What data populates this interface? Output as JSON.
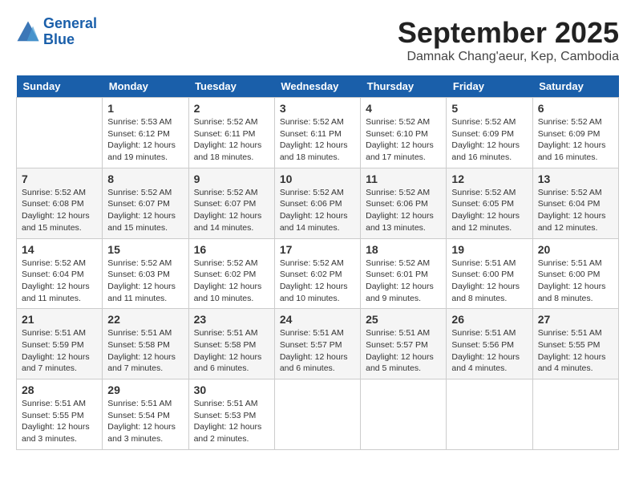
{
  "header": {
    "logo_line1": "General",
    "logo_line2": "Blue",
    "month_title": "September 2025",
    "subtitle": "Damnak Chang'aeur, Kep, Cambodia"
  },
  "weekdays": [
    "Sunday",
    "Monday",
    "Tuesday",
    "Wednesday",
    "Thursday",
    "Friday",
    "Saturday"
  ],
  "weeks": [
    [
      {
        "day": "",
        "info": ""
      },
      {
        "day": "1",
        "info": "Sunrise: 5:53 AM\nSunset: 6:12 PM\nDaylight: 12 hours\nand 19 minutes."
      },
      {
        "day": "2",
        "info": "Sunrise: 5:52 AM\nSunset: 6:11 PM\nDaylight: 12 hours\nand 18 minutes."
      },
      {
        "day": "3",
        "info": "Sunrise: 5:52 AM\nSunset: 6:11 PM\nDaylight: 12 hours\nand 18 minutes."
      },
      {
        "day": "4",
        "info": "Sunrise: 5:52 AM\nSunset: 6:10 PM\nDaylight: 12 hours\nand 17 minutes."
      },
      {
        "day": "5",
        "info": "Sunrise: 5:52 AM\nSunset: 6:09 PM\nDaylight: 12 hours\nand 16 minutes."
      },
      {
        "day": "6",
        "info": "Sunrise: 5:52 AM\nSunset: 6:09 PM\nDaylight: 12 hours\nand 16 minutes."
      }
    ],
    [
      {
        "day": "7",
        "info": "Sunrise: 5:52 AM\nSunset: 6:08 PM\nDaylight: 12 hours\nand 15 minutes."
      },
      {
        "day": "8",
        "info": "Sunrise: 5:52 AM\nSunset: 6:07 PM\nDaylight: 12 hours\nand 15 minutes."
      },
      {
        "day": "9",
        "info": "Sunrise: 5:52 AM\nSunset: 6:07 PM\nDaylight: 12 hours\nand 14 minutes."
      },
      {
        "day": "10",
        "info": "Sunrise: 5:52 AM\nSunset: 6:06 PM\nDaylight: 12 hours\nand 14 minutes."
      },
      {
        "day": "11",
        "info": "Sunrise: 5:52 AM\nSunset: 6:06 PM\nDaylight: 12 hours\nand 13 minutes."
      },
      {
        "day": "12",
        "info": "Sunrise: 5:52 AM\nSunset: 6:05 PM\nDaylight: 12 hours\nand 12 minutes."
      },
      {
        "day": "13",
        "info": "Sunrise: 5:52 AM\nSunset: 6:04 PM\nDaylight: 12 hours\nand 12 minutes."
      }
    ],
    [
      {
        "day": "14",
        "info": "Sunrise: 5:52 AM\nSunset: 6:04 PM\nDaylight: 12 hours\nand 11 minutes."
      },
      {
        "day": "15",
        "info": "Sunrise: 5:52 AM\nSunset: 6:03 PM\nDaylight: 12 hours\nand 11 minutes."
      },
      {
        "day": "16",
        "info": "Sunrise: 5:52 AM\nSunset: 6:02 PM\nDaylight: 12 hours\nand 10 minutes."
      },
      {
        "day": "17",
        "info": "Sunrise: 5:52 AM\nSunset: 6:02 PM\nDaylight: 12 hours\nand 10 minutes."
      },
      {
        "day": "18",
        "info": "Sunrise: 5:52 AM\nSunset: 6:01 PM\nDaylight: 12 hours\nand 9 minutes."
      },
      {
        "day": "19",
        "info": "Sunrise: 5:51 AM\nSunset: 6:00 PM\nDaylight: 12 hours\nand 8 minutes."
      },
      {
        "day": "20",
        "info": "Sunrise: 5:51 AM\nSunset: 6:00 PM\nDaylight: 12 hours\nand 8 minutes."
      }
    ],
    [
      {
        "day": "21",
        "info": "Sunrise: 5:51 AM\nSunset: 5:59 PM\nDaylight: 12 hours\nand 7 minutes."
      },
      {
        "day": "22",
        "info": "Sunrise: 5:51 AM\nSunset: 5:58 PM\nDaylight: 12 hours\nand 7 minutes."
      },
      {
        "day": "23",
        "info": "Sunrise: 5:51 AM\nSunset: 5:58 PM\nDaylight: 12 hours\nand 6 minutes."
      },
      {
        "day": "24",
        "info": "Sunrise: 5:51 AM\nSunset: 5:57 PM\nDaylight: 12 hours\nand 6 minutes."
      },
      {
        "day": "25",
        "info": "Sunrise: 5:51 AM\nSunset: 5:57 PM\nDaylight: 12 hours\nand 5 minutes."
      },
      {
        "day": "26",
        "info": "Sunrise: 5:51 AM\nSunset: 5:56 PM\nDaylight: 12 hours\nand 4 minutes."
      },
      {
        "day": "27",
        "info": "Sunrise: 5:51 AM\nSunset: 5:55 PM\nDaylight: 12 hours\nand 4 minutes."
      }
    ],
    [
      {
        "day": "28",
        "info": "Sunrise: 5:51 AM\nSunset: 5:55 PM\nDaylight: 12 hours\nand 3 minutes."
      },
      {
        "day": "29",
        "info": "Sunrise: 5:51 AM\nSunset: 5:54 PM\nDaylight: 12 hours\nand 3 minutes."
      },
      {
        "day": "30",
        "info": "Sunrise: 5:51 AM\nSunset: 5:53 PM\nDaylight: 12 hours\nand 2 minutes."
      },
      {
        "day": "",
        "info": ""
      },
      {
        "day": "",
        "info": ""
      },
      {
        "day": "",
        "info": ""
      },
      {
        "day": "",
        "info": ""
      }
    ]
  ]
}
